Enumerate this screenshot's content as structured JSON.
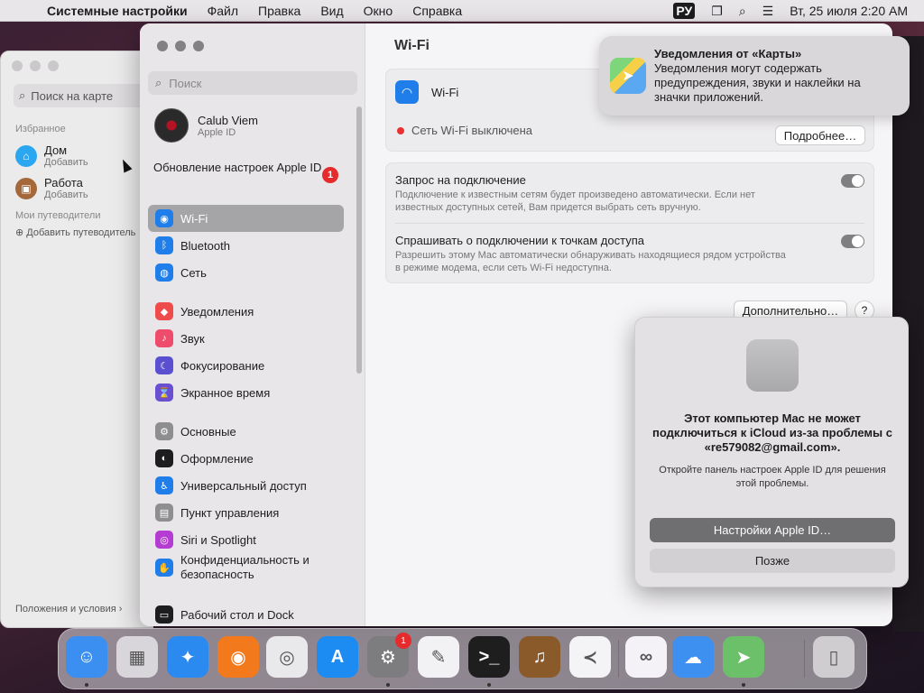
{
  "menubar": {
    "app_name": "Системные настройки",
    "items": [
      "Файл",
      "Правка",
      "Вид",
      "Окно",
      "Справка"
    ],
    "lang": "РУ",
    "clock": "Вт, 25 июля  2:20 AM"
  },
  "maps": {
    "search_placeholder": "Поиск на карте",
    "favorites_label": "Избранное",
    "home_title": "Дом",
    "home_sub": "Добавить",
    "work_title": "Работа",
    "work_sub": "Добавить",
    "guides_label": "Мои путеводители",
    "add_guide": "Добавить путеводитель",
    "footer": "Положения и условия"
  },
  "sidebar": {
    "search_placeholder": "Поиск",
    "account_name": "Calub Viem",
    "account_sub": "Apple ID",
    "update_text": "Обновление настроек Apple ID",
    "update_badge": "1",
    "items": [
      {
        "label": "Wi-Fi",
        "color": "#1f7ee9",
        "glyph": "◉"
      },
      {
        "label": "Bluetooth",
        "color": "#1f7ee9",
        "glyph": "ᛒ"
      },
      {
        "label": "Сеть",
        "color": "#1f7ee9",
        "glyph": "◍"
      },
      {
        "label": "Уведомления",
        "color": "#ef4b4b",
        "glyph": "◆"
      },
      {
        "label": "Звук",
        "color": "#ef4b6b",
        "glyph": "♪"
      },
      {
        "label": "Фокусирование",
        "color": "#5a4fd1",
        "glyph": "☾"
      },
      {
        "label": "Экранное время",
        "color": "#6a4fd1",
        "glyph": "⌛"
      },
      {
        "label": "Основные",
        "color": "#8e8d90",
        "glyph": "⚙"
      },
      {
        "label": "Оформление",
        "color": "#1d1d1f",
        "glyph": "◐"
      },
      {
        "label": "Универсальный доступ",
        "color": "#1f7ee9",
        "glyph": "♿"
      },
      {
        "label": "Пункт управления",
        "color": "#8e8d90",
        "glyph": "▤"
      },
      {
        "label": "Siri и Spotlight",
        "color": "#b43cd3",
        "glyph": "◎"
      },
      {
        "label": "Конфиденциальность и безопасность",
        "color": "#1f7ee9",
        "glyph": "✋"
      },
      {
        "label": "Рабочий стол и Dock",
        "color": "#1d1d1f",
        "glyph": "▭"
      }
    ]
  },
  "content": {
    "title": "Wi-Fi",
    "wifi_label": "Wi-Fi",
    "status": "Сеть Wi-Fi выключена",
    "details_button": "Подробнее…",
    "ask_join_title": "Запрос на подключение",
    "ask_join_desc": "Подключение к известным сетям будет произведено автоматически. Если нет известных доступных сетей, Вам придется выбрать сеть вручную.",
    "ask_hotspot_title": "Спрашивать о подключении к точкам доступа",
    "ask_hotspot_desc": "Разрешить этому Mac автоматически обнаруживать находящиеся рядом устройства в режиме модема, если сеть Wi-Fi недоступна.",
    "advanced_button": "Дополнительно…",
    "help_button": "?"
  },
  "notification": {
    "title": "Уведомления от «Карты»",
    "body": "Уведомления могут содержать предупреждения, звуки и наклейки на значки приложений."
  },
  "alert": {
    "title": "Этот компьютер Mac не может подключиться к iCloud из-за проблемы с «re579082@gmail.com».",
    "body": "Откройте панель настроек Apple ID для решения этой проблемы.",
    "primary_button": "Настройки Apple ID…",
    "secondary_button": "Позже"
  },
  "dock": {
    "settings_badge": "1",
    "apps": [
      {
        "name": "finder",
        "color": "#3a8ff0",
        "glyph": "☺"
      },
      {
        "name": "launchpad",
        "color": "#d8d6da",
        "glyph": "▦"
      },
      {
        "name": "safari",
        "color": "#2b8af0",
        "glyph": "✦"
      },
      {
        "name": "firefox",
        "color": "#f27a1d",
        "glyph": "◉"
      },
      {
        "name": "chrome",
        "color": "#e9e8ea",
        "glyph": "◎"
      },
      {
        "name": "app-store",
        "color": "#1c8cf3",
        "glyph": "A"
      },
      {
        "name": "system-settings",
        "color": "#7d7c7f",
        "glyph": "⚙"
      },
      {
        "name": "textedit",
        "color": "#f2f1f3",
        "glyph": "✎"
      },
      {
        "name": "terminal",
        "color": "#1e1e1e",
        "glyph": ">_"
      },
      {
        "name": "instruments",
        "color": "#8a5a2a",
        "glyph": "♫"
      },
      {
        "name": "vscode",
        "color": "#f4f4f6",
        "glyph": "≺"
      },
      {
        "name": "visual-studio",
        "color": "#f4f2f6",
        "glyph": "∞"
      },
      {
        "name": "weather",
        "color": "#3d8ff0",
        "glyph": "☁"
      },
      {
        "name": "maps",
        "color": "#6cc06a",
        "glyph": "➤"
      },
      {
        "name": "trash",
        "color": "#cfcdd0",
        "glyph": "▯"
      }
    ]
  }
}
